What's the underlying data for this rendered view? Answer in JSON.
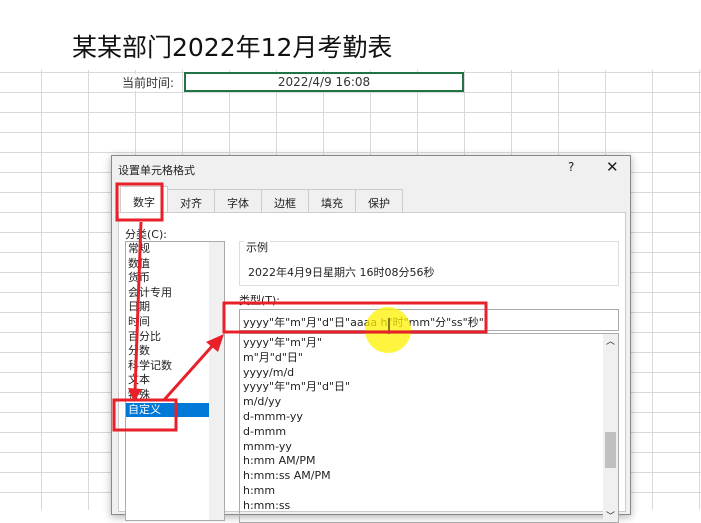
{
  "sheet": {
    "title": "某某部门2022年12月考勤表",
    "time_label": "当前时间:",
    "time_value": "2022/4/9 16:08"
  },
  "dialog": {
    "title": "设置单元格格式",
    "help": "?",
    "close": "✕",
    "tabs": [
      "数字",
      "对齐",
      "字体",
      "边框",
      "填充",
      "保护"
    ],
    "category_label": "分类(C):",
    "categories": [
      "常规",
      "数值",
      "货币",
      "会计专用",
      "日期",
      "时间",
      "百分比",
      "分数",
      "科学记数",
      "文本",
      "特殊",
      "自定义"
    ],
    "sample_label": "示例",
    "sample_value": "2022年4月9日星期六 16时08分56秒",
    "type_label": "类型(T):",
    "type_value": "yyyy\"年\"m\"月\"d\"日\"aaaa h\"时\"mm\"分\"ss\"秒\"",
    "type_list": [
      "yyyy\"年\"m\"月\"",
      "m\"月\"d\"日\"",
      "yyyy/m/d",
      "yyyy\"年\"m\"月\"d\"日\"",
      "m/d/yy",
      "d-mmm-yy",
      "d-mmm",
      "mmm-yy",
      "h:mm AM/PM",
      "h:mm:ss AM/PM",
      "h:mm",
      "h:mm:ss"
    ]
  },
  "colors": {
    "annotation": "#e8202a",
    "highlight": "#fff200",
    "selection": "#0078d7"
  }
}
